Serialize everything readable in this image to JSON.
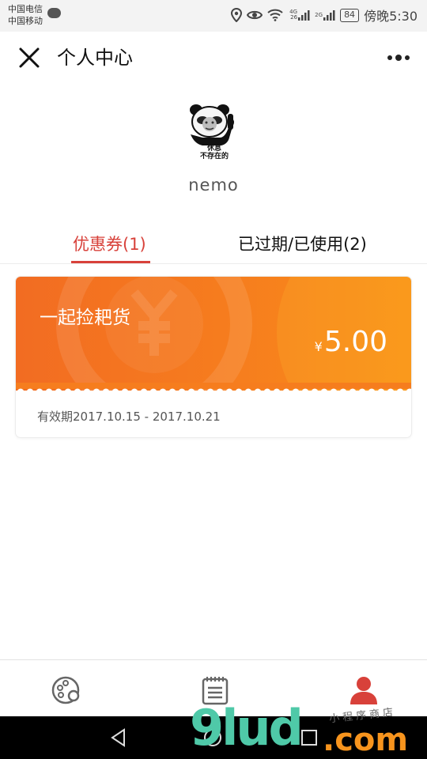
{
  "status_bar": {
    "carrier_1": "中国电信",
    "carrier_2": "中国移动",
    "network_1": "4G 26",
    "network_2": "2G",
    "battery": "84",
    "time": "傍晚5:30"
  },
  "header": {
    "title": "个人中心",
    "close_icon": "close-icon",
    "more_icon": "more-dots-icon"
  },
  "profile": {
    "avatar_caption_line1": "休息",
    "avatar_caption_line2": "不存在的",
    "username": "nemo"
  },
  "tabs": [
    {
      "label": "优惠券(1)",
      "active": true
    },
    {
      "label": "已过期/已使用(2)",
      "active": false
    }
  ],
  "coupon": {
    "name": "一起捡耙货",
    "currency": "¥",
    "amount": "5.00",
    "validity": "有效期2017.10.15 - 2017.10.21",
    "gradient_start": "#f26c22",
    "gradient_end": "#fa8f18"
  },
  "bottom_nav": [
    {
      "icon": "palette-icon",
      "active": false
    },
    {
      "icon": "notepad-icon",
      "active": false
    },
    {
      "icon": "user-icon",
      "active": true
    }
  ],
  "watermark": {
    "logo": "9lud",
    "domain": ".com",
    "small_text": "小程序商店"
  },
  "colors": {
    "accent": "#d8413a",
    "coupon_orange": "#f67d1e",
    "watermark_green": "#4fc9a8",
    "watermark_orange": "#f7941d"
  }
}
